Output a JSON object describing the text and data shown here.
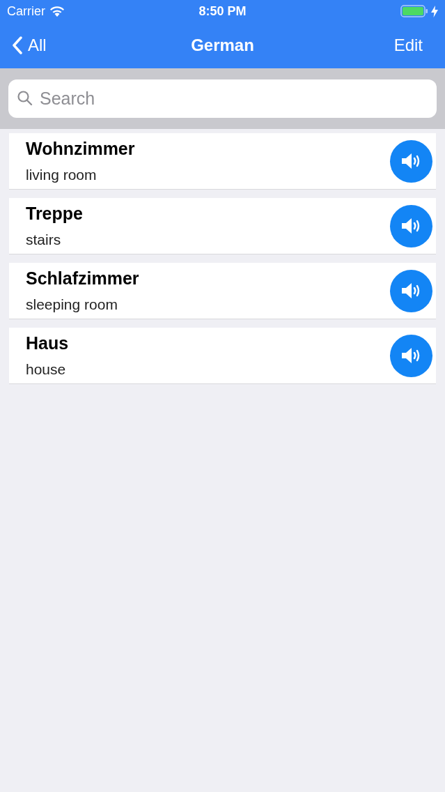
{
  "status_bar": {
    "carrier": "Carrier",
    "time": "8:50 PM"
  },
  "nav": {
    "back": "All",
    "title": "German",
    "action": "Edit"
  },
  "search": {
    "placeholder": "Search"
  },
  "words": [
    {
      "word": "Wohnzimmer",
      "translation": "living room"
    },
    {
      "word": "Treppe",
      "translation": "stairs"
    },
    {
      "word": "Schlafzimmer",
      "translation": "sleeping room"
    },
    {
      "word": "Haus",
      "translation": "house"
    }
  ]
}
